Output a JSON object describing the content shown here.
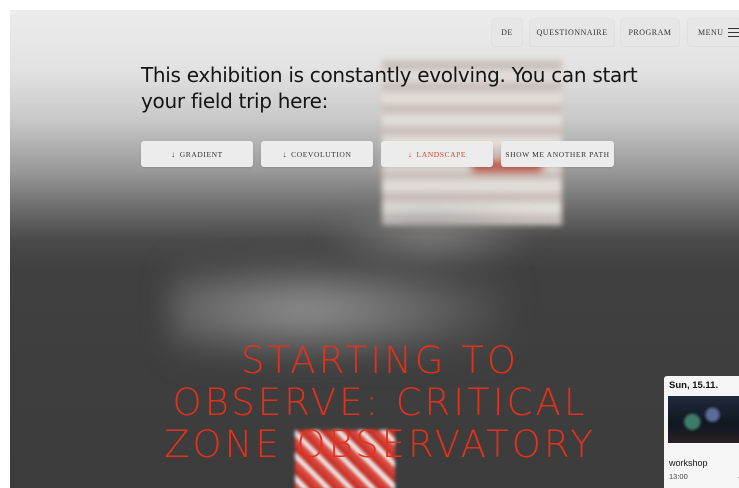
{
  "header": {
    "lang_label": "DE",
    "questionnaire_label": "QUESTIONNAIRE",
    "program_label": "PROGRAM",
    "menu_label": "MENU"
  },
  "intro": {
    "text": "This exhibition is constantly evolving. You can start your field trip here:"
  },
  "paths": [
    {
      "arrow": "↓",
      "label": "GRADIENT"
    },
    {
      "arrow": "↓",
      "label": "COEVOLUTION"
    },
    {
      "arrow": "↓",
      "label": "LANDSCAPE"
    },
    {
      "label": "SHOW ME ANOTHER PATH"
    }
  ],
  "hero": {
    "title": "STARTING TO OBSERVE: CRITICAL ZONE OBSERVATORY"
  },
  "event": {
    "date": "Sun, 15.11.",
    "type": "workshop",
    "time": "13:00",
    "arrow": "→"
  },
  "colors": {
    "accent": "#e5311b",
    "landscape_label": "#d2462e",
    "button_bg": "#ececec"
  },
  "icons": {
    "menu": "hamburger-icon",
    "path_arrow": "arrow-down-icon",
    "event_arrow": "arrow-right-icon"
  }
}
